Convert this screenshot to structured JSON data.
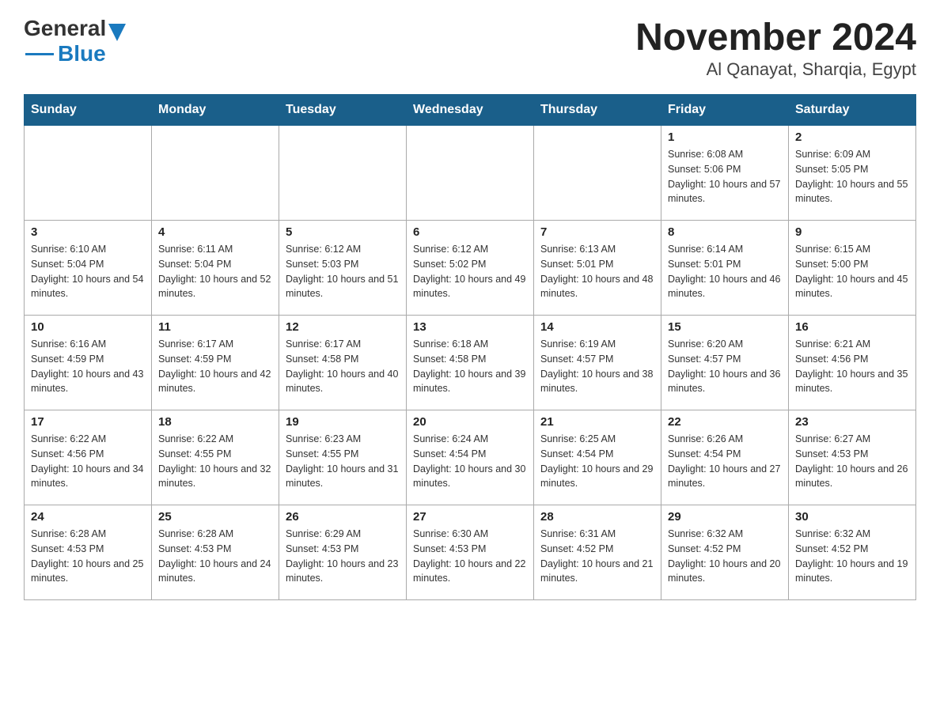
{
  "header": {
    "logo_general": "General",
    "logo_blue": "Blue",
    "title": "November 2024",
    "subtitle": "Al Qanayat, Sharqia, Egypt"
  },
  "days_of_week": [
    "Sunday",
    "Monday",
    "Tuesday",
    "Wednesday",
    "Thursday",
    "Friday",
    "Saturday"
  ],
  "weeks": [
    [
      {
        "day": "",
        "sunrise": "",
        "sunset": "",
        "daylight": ""
      },
      {
        "day": "",
        "sunrise": "",
        "sunset": "",
        "daylight": ""
      },
      {
        "day": "",
        "sunrise": "",
        "sunset": "",
        "daylight": ""
      },
      {
        "day": "",
        "sunrise": "",
        "sunset": "",
        "daylight": ""
      },
      {
        "day": "",
        "sunrise": "",
        "sunset": "",
        "daylight": ""
      },
      {
        "day": "1",
        "sunrise": "Sunrise: 6:08 AM",
        "sunset": "Sunset: 5:06 PM",
        "daylight": "Daylight: 10 hours and 57 minutes."
      },
      {
        "day": "2",
        "sunrise": "Sunrise: 6:09 AM",
        "sunset": "Sunset: 5:05 PM",
        "daylight": "Daylight: 10 hours and 55 minutes."
      }
    ],
    [
      {
        "day": "3",
        "sunrise": "Sunrise: 6:10 AM",
        "sunset": "Sunset: 5:04 PM",
        "daylight": "Daylight: 10 hours and 54 minutes."
      },
      {
        "day": "4",
        "sunrise": "Sunrise: 6:11 AM",
        "sunset": "Sunset: 5:04 PM",
        "daylight": "Daylight: 10 hours and 52 minutes."
      },
      {
        "day": "5",
        "sunrise": "Sunrise: 6:12 AM",
        "sunset": "Sunset: 5:03 PM",
        "daylight": "Daylight: 10 hours and 51 minutes."
      },
      {
        "day": "6",
        "sunrise": "Sunrise: 6:12 AM",
        "sunset": "Sunset: 5:02 PM",
        "daylight": "Daylight: 10 hours and 49 minutes."
      },
      {
        "day": "7",
        "sunrise": "Sunrise: 6:13 AM",
        "sunset": "Sunset: 5:01 PM",
        "daylight": "Daylight: 10 hours and 48 minutes."
      },
      {
        "day": "8",
        "sunrise": "Sunrise: 6:14 AM",
        "sunset": "Sunset: 5:01 PM",
        "daylight": "Daylight: 10 hours and 46 minutes."
      },
      {
        "day": "9",
        "sunrise": "Sunrise: 6:15 AM",
        "sunset": "Sunset: 5:00 PM",
        "daylight": "Daylight: 10 hours and 45 minutes."
      }
    ],
    [
      {
        "day": "10",
        "sunrise": "Sunrise: 6:16 AM",
        "sunset": "Sunset: 4:59 PM",
        "daylight": "Daylight: 10 hours and 43 minutes."
      },
      {
        "day": "11",
        "sunrise": "Sunrise: 6:17 AM",
        "sunset": "Sunset: 4:59 PM",
        "daylight": "Daylight: 10 hours and 42 minutes."
      },
      {
        "day": "12",
        "sunrise": "Sunrise: 6:17 AM",
        "sunset": "Sunset: 4:58 PM",
        "daylight": "Daylight: 10 hours and 40 minutes."
      },
      {
        "day": "13",
        "sunrise": "Sunrise: 6:18 AM",
        "sunset": "Sunset: 4:58 PM",
        "daylight": "Daylight: 10 hours and 39 minutes."
      },
      {
        "day": "14",
        "sunrise": "Sunrise: 6:19 AM",
        "sunset": "Sunset: 4:57 PM",
        "daylight": "Daylight: 10 hours and 38 minutes."
      },
      {
        "day": "15",
        "sunrise": "Sunrise: 6:20 AM",
        "sunset": "Sunset: 4:57 PM",
        "daylight": "Daylight: 10 hours and 36 minutes."
      },
      {
        "day": "16",
        "sunrise": "Sunrise: 6:21 AM",
        "sunset": "Sunset: 4:56 PM",
        "daylight": "Daylight: 10 hours and 35 minutes."
      }
    ],
    [
      {
        "day": "17",
        "sunrise": "Sunrise: 6:22 AM",
        "sunset": "Sunset: 4:56 PM",
        "daylight": "Daylight: 10 hours and 34 minutes."
      },
      {
        "day": "18",
        "sunrise": "Sunrise: 6:22 AM",
        "sunset": "Sunset: 4:55 PM",
        "daylight": "Daylight: 10 hours and 32 minutes."
      },
      {
        "day": "19",
        "sunrise": "Sunrise: 6:23 AM",
        "sunset": "Sunset: 4:55 PM",
        "daylight": "Daylight: 10 hours and 31 minutes."
      },
      {
        "day": "20",
        "sunrise": "Sunrise: 6:24 AM",
        "sunset": "Sunset: 4:54 PM",
        "daylight": "Daylight: 10 hours and 30 minutes."
      },
      {
        "day": "21",
        "sunrise": "Sunrise: 6:25 AM",
        "sunset": "Sunset: 4:54 PM",
        "daylight": "Daylight: 10 hours and 29 minutes."
      },
      {
        "day": "22",
        "sunrise": "Sunrise: 6:26 AM",
        "sunset": "Sunset: 4:54 PM",
        "daylight": "Daylight: 10 hours and 27 minutes."
      },
      {
        "day": "23",
        "sunrise": "Sunrise: 6:27 AM",
        "sunset": "Sunset: 4:53 PM",
        "daylight": "Daylight: 10 hours and 26 minutes."
      }
    ],
    [
      {
        "day": "24",
        "sunrise": "Sunrise: 6:28 AM",
        "sunset": "Sunset: 4:53 PM",
        "daylight": "Daylight: 10 hours and 25 minutes."
      },
      {
        "day": "25",
        "sunrise": "Sunrise: 6:28 AM",
        "sunset": "Sunset: 4:53 PM",
        "daylight": "Daylight: 10 hours and 24 minutes."
      },
      {
        "day": "26",
        "sunrise": "Sunrise: 6:29 AM",
        "sunset": "Sunset: 4:53 PM",
        "daylight": "Daylight: 10 hours and 23 minutes."
      },
      {
        "day": "27",
        "sunrise": "Sunrise: 6:30 AM",
        "sunset": "Sunset: 4:53 PM",
        "daylight": "Daylight: 10 hours and 22 minutes."
      },
      {
        "day": "28",
        "sunrise": "Sunrise: 6:31 AM",
        "sunset": "Sunset: 4:52 PM",
        "daylight": "Daylight: 10 hours and 21 minutes."
      },
      {
        "day": "29",
        "sunrise": "Sunrise: 6:32 AM",
        "sunset": "Sunset: 4:52 PM",
        "daylight": "Daylight: 10 hours and 20 minutes."
      },
      {
        "day": "30",
        "sunrise": "Sunrise: 6:32 AM",
        "sunset": "Sunset: 4:52 PM",
        "daylight": "Daylight: 10 hours and 19 minutes."
      }
    ]
  ]
}
